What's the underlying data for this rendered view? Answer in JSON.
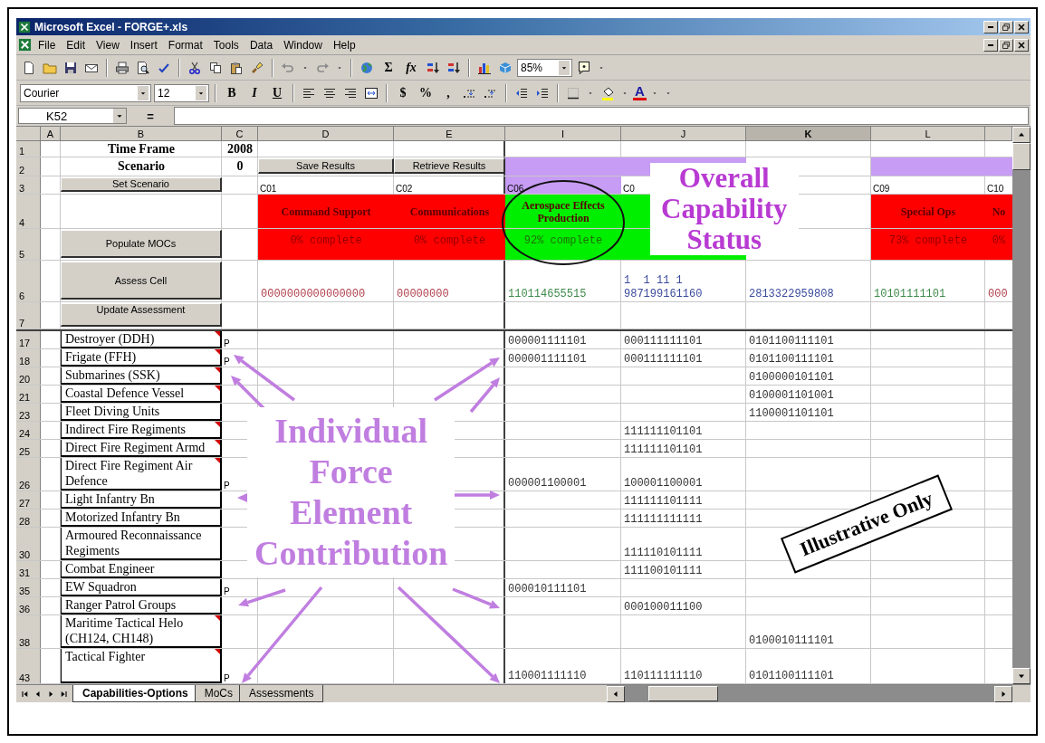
{
  "window": {
    "title": "Microsoft Excel - FORGE+.xls"
  },
  "menu": [
    "File",
    "Edit",
    "View",
    "Insert",
    "Format",
    "Tools",
    "Data",
    "Window",
    "Help"
  ],
  "standard_toolbar": [
    {
      "kind": "button",
      "text": "Σ"
    },
    {
      "kind": "function_button",
      "text": "fx"
    },
    {
      "kind": "combo",
      "text": "85%"
    }
  ],
  "formatting_toolbar": [
    {
      "kind": "wide_combo",
      "text": "Courier"
    },
    {
      "kind": "combo",
      "text": "12"
    },
    {
      "kind": "bold_button",
      "text": "B"
    },
    {
      "kind": "italic_button",
      "text": "I"
    },
    {
      "kind": "underline_button",
      "text": "U"
    },
    {
      "kind": "button",
      "text": "$"
    },
    {
      "kind": "button",
      "text": "%"
    },
    {
      "kind": "button",
      "text": ","
    },
    {
      "kind": "color_button",
      "text": "A"
    }
  ],
  "formula_bar": {
    "name_box": "K52",
    "equals": "="
  },
  "columns": [
    {
      "label": "A",
      "selected": false
    },
    {
      "label": "B",
      "selected": false
    },
    {
      "label": "C",
      "selected": false
    },
    {
      "label": "D",
      "selected": false
    },
    {
      "label": "E",
      "selected": false
    },
    {
      "label": "I",
      "selected": false
    },
    {
      "label": "J",
      "selected": false
    },
    {
      "label": "K",
      "selected": true
    },
    {
      "label": "L",
      "selected": false
    }
  ],
  "frozen_rows": [
    {
      "header": "1",
      "cells": [
        null,
        {
          "kind": "label",
          "text": "Time Frame"
        },
        {
          "kind": "label",
          "text": "2008"
        },
        null,
        null,
        null,
        null,
        null,
        null,
        null
      ]
    },
    {
      "header": "2",
      "cells": [
        null,
        {
          "kind": "label",
          "text": "Scenario"
        },
        {
          "kind": "label",
          "text": "0"
        },
        {
          "kind": "button",
          "text": "Save Results"
        },
        {
          "kind": "button",
          "text": "Retrieve Results"
        },
        {
          "kind": "band",
          "color": "#c79cf4"
        },
        {
          "kind": "band",
          "color": "#c79cf4"
        },
        null,
        {
          "kind": "band",
          "color": "#c79cf4"
        },
        {
          "kind": "band",
          "color": "#c79cf4"
        }
      ]
    },
    {
      "header": "3",
      "cells": [
        null,
        {
          "kind": "button",
          "text": "Set Scenario"
        },
        null,
        {
          "kind": "code",
          "text": "C01"
        },
        {
          "kind": "code",
          "text": "C02"
        },
        {
          "kind": "band",
          "color": "#c79cf4",
          "text": "C06"
        },
        {
          "kind": "code",
          "text": "C0"
        },
        null,
        {
          "kind": "code",
          "text": "C09"
        },
        {
          "kind": "code",
          "text": "C10"
        }
      ]
    },
    {
      "header": "4",
      "cells": [
        null,
        null,
        null,
        {
          "kind": "capability",
          "color": "#ff0000",
          "text": "Command Support"
        },
        {
          "kind": "capability",
          "color": "#ff0000",
          "text": "Communications"
        },
        {
          "kind": "capability",
          "color": "#00ee00",
          "text": "Aerospace Effects Production"
        },
        {
          "kind": "capability",
          "color": "#00ee00"
        },
        null,
        {
          "kind": "capability",
          "color": "#ff0000",
          "text": "Special Ops"
        },
        {
          "kind": "capability",
          "color": "#ff0000",
          "text": "No"
        }
      ]
    },
    {
      "header": "5",
      "cells": [
        null,
        {
          "kind": "button",
          "text": "Populate MOCs"
        },
        null,
        {
          "kind": "status",
          "color": "#ff0000",
          "text": "0% complete"
        },
        {
          "kind": "status",
          "color": "#ff0000",
          "text": "0% complete"
        },
        {
          "kind": "status",
          "color": "#00ee00",
          "text": "92% complete"
        },
        {
          "kind": "status",
          "color": "#00ee00"
        },
        null,
        {
          "kind": "status",
          "color": "#ff0000",
          "text": "73% complete"
        },
        {
          "kind": "status",
          "color": "#ff0000",
          "text": "0%"
        }
      ]
    },
    {
      "header": "6",
      "cells": [
        null,
        {
          "kind": "button",
          "text": "Assess Cell"
        },
        null,
        {
          "kind": "digits",
          "color": "#b0404c",
          "text": "0000000000000000"
        },
        {
          "kind": "digits",
          "color": "#b0404c",
          "text": "00000000"
        },
        {
          "kind": "digits",
          "color": "#3f8a4a",
          "text": "110114655515"
        },
        {
          "kind": "digits",
          "color": "#3b4b9c",
          "text": "1  1 11 1\n987199161160"
        },
        {
          "kind": "digits",
          "color": "#3b4b9c",
          "text": "2813322959808"
        },
        {
          "kind": "digits",
          "color": "#3f8a4a",
          "text": "10101111101"
        },
        {
          "kind": "digits",
          "color": "#b0404c",
          "text": "000"
        }
      ]
    },
    {
      "header": "7",
      "cells": [
        null,
        {
          "kind": "button",
          "text": "Update Assessment"
        },
        null,
        null,
        null,
        null,
        null,
        null,
        null,
        null
      ]
    }
  ],
  "rows": [
    {
      "header": "17",
      "cells": [
        null,
        {
          "kind": "item",
          "text": "Destroyer (DDH)",
          "comment": true
        },
        {
          "kind": "mark",
          "text": "P"
        },
        null,
        null,
        {
          "kind": "digits",
          "text": "000001111101"
        },
        {
          "kind": "digits",
          "text": "000111111101"
        },
        {
          "kind": "digits",
          "text": "0101100111101"
        },
        null,
        null
      ]
    },
    {
      "header": "18",
      "cells": [
        null,
        {
          "kind": "item",
          "text": "Frigate (FFH)",
          "comment": true
        },
        {
          "kind": "mark",
          "text": "P"
        },
        null,
        null,
        {
          "kind": "digits",
          "text": "000001111101"
        },
        {
          "kind": "digits",
          "text": "000111111101"
        },
        {
          "kind": "digits",
          "text": "0101100111101"
        },
        null,
        null
      ]
    },
    {
      "header": "20",
      "cells": [
        null,
        {
          "kind": "item",
          "text": "Submarines (SSK)",
          "comment": true
        },
        null,
        null,
        null,
        null,
        null,
        {
          "kind": "digits",
          "text": "0100000101101"
        },
        null,
        null
      ]
    },
    {
      "header": "21",
      "cells": [
        null,
        {
          "kind": "item",
          "text": "Coastal Defence Vessel",
          "comment": true
        },
        null,
        null,
        null,
        null,
        null,
        {
          "kind": "digits",
          "text": "0100001101001"
        },
        null,
        null
      ]
    },
    {
      "header": "23",
      "cells": [
        null,
        {
          "kind": "item",
          "text": "Fleet Diving Units",
          "comment": false
        },
        null,
        null,
        null,
        null,
        null,
        {
          "kind": "digits",
          "text": "1100001101101"
        },
        null,
        null
      ]
    },
    {
      "header": "24",
      "cells": [
        null,
        {
          "kind": "item",
          "text": "Indirect Fire Regiments",
          "comment": true
        },
        null,
        null,
        null,
        null,
        {
          "kind": "digits",
          "text": "111111101101"
        },
        null,
        null,
        null
      ]
    },
    {
      "header": "25",
      "cells": [
        null,
        {
          "kind": "item",
          "text": "Direct Fire Regiment Armd",
          "comment": true
        },
        null,
        null,
        null,
        null,
        {
          "kind": "digits",
          "text": "111111101101"
        },
        null,
        null,
        null
      ]
    },
    {
      "header": "26",
      "cells": [
        null,
        {
          "kind": "item",
          "text": "Direct Fire Regiment Air Defence",
          "comment": true
        },
        {
          "kind": "mark",
          "text": "P"
        },
        null,
        null,
        {
          "kind": "digits",
          "text": "000001100001"
        },
        {
          "kind": "digits",
          "text": "100001100001"
        },
        null,
        null,
        null
      ]
    },
    {
      "header": "27",
      "cells": [
        null,
        {
          "kind": "item",
          "text": "Light Infantry Bn",
          "comment": false
        },
        null,
        null,
        null,
        null,
        {
          "kind": "digits",
          "text": "111111101111"
        },
        null,
        null,
        null
      ]
    },
    {
      "header": "28",
      "cells": [
        null,
        {
          "kind": "item",
          "text": "Motorized Infantry Bn",
          "comment": false
        },
        null,
        null,
        null,
        null,
        {
          "kind": "digits",
          "text": "111111111111"
        },
        null,
        null,
        null
      ]
    },
    {
      "header": "30",
      "cells": [
        null,
        {
          "kind": "item",
          "text": "Armoured Reconnaissance Regiments",
          "comment": false
        },
        null,
        null,
        null,
        null,
        {
          "kind": "digits",
          "text": "111110101111"
        },
        null,
        null,
        null
      ]
    },
    {
      "header": "31",
      "cells": [
        null,
        {
          "kind": "item",
          "text": "Combat Engineer",
          "comment": false
        },
        null,
        null,
        null,
        null,
        {
          "kind": "digits",
          "text": "111100101111"
        },
        null,
        null,
        null
      ]
    },
    {
      "header": "35",
      "cells": [
        null,
        {
          "kind": "item",
          "text": "EW Squadron",
          "comment": false
        },
        {
          "kind": "mark",
          "text": "P"
        },
        null,
        null,
        {
          "kind": "digits",
          "text": "000010111101"
        },
        null,
        null,
        null,
        null
      ]
    },
    {
      "header": "36",
      "cells": [
        null,
        {
          "kind": "item",
          "text": "Ranger Patrol Groups",
          "comment": false
        },
        null,
        null,
        null,
        null,
        {
          "kind": "digits",
          "text": "000100011100"
        },
        null,
        null,
        null
      ]
    },
    {
      "header": "38",
      "cells": [
        null,
        {
          "kind": "item",
          "text": "Maritime Tactical Helo (CH124, CH148)",
          "comment": true
        },
        null,
        null,
        null,
        null,
        null,
        {
          "kind": "digits",
          "text": "0100010111101"
        },
        null,
        null
      ]
    },
    {
      "header": "43",
      "cells": [
        null,
        {
          "kind": "item",
          "text": "Tactical Fighter",
          "comment": true
        },
        {
          "kind": "mark",
          "text": "P"
        },
        null,
        null,
        {
          "kind": "digits",
          "text": "110001111110"
        },
        {
          "kind": "digits",
          "text": "110111111110"
        },
        {
          "kind": "digits",
          "text": "0101100111101"
        },
        null,
        null
      ]
    }
  ],
  "overlays": {
    "status_caption": "Overall Capability Status",
    "contribution_caption": "Individual Force Element Contribution",
    "stamp": "Illustrative Only"
  },
  "sheet_tabs": [
    {
      "label": "Capabilities-Options",
      "selected": true
    },
    {
      "label": "MoCs",
      "selected": false
    },
    {
      "label": "Assessments",
      "selected": false
    }
  ]
}
